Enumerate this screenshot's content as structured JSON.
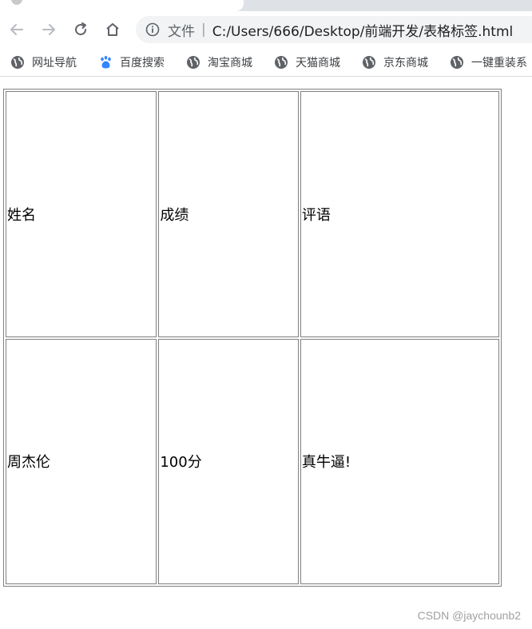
{
  "browser": {
    "address_bar": {
      "scheme_label": "文件",
      "separator": "|",
      "url": "C:/Users/666/Desktop/前端开发/表格标签.html"
    },
    "bookmarks": [
      {
        "label": "网址导航",
        "icon": "globe-icon"
      },
      {
        "label": "百度搜索",
        "icon": "baidu-paw-icon"
      },
      {
        "label": "淘宝商城",
        "icon": "globe-icon"
      },
      {
        "label": "天猫商城",
        "icon": "globe-icon"
      },
      {
        "label": "京东商城",
        "icon": "globe-icon"
      },
      {
        "label": "一键重装系",
        "icon": "globe-icon"
      }
    ]
  },
  "table": {
    "header_row": [
      "姓名",
      "成绩",
      "评语"
    ],
    "rows": [
      [
        "周杰伦",
        "100分",
        "真牛逼!"
      ]
    ]
  },
  "watermark": "CSDN @jaychounb2",
  "colors": {
    "accent_baidu": "#3385ff",
    "border": "#808080",
    "tab_strip": "#dee1e6",
    "omnibox_bg": "#f1f3f4"
  }
}
